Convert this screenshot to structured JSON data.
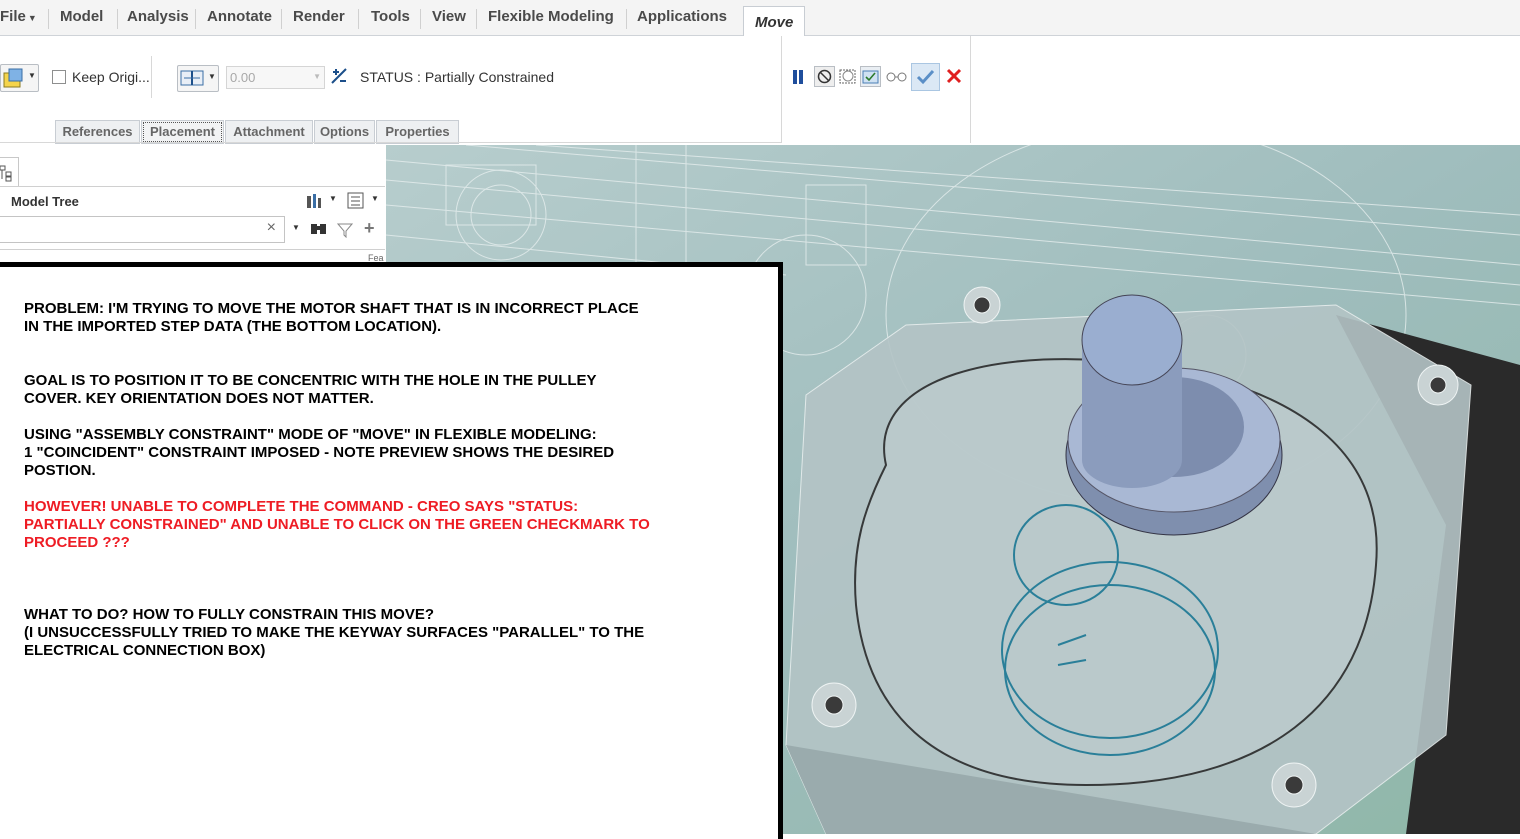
{
  "menu": {
    "file": "File",
    "model": "Model",
    "analysis": "Analysis",
    "annotate": "Annotate",
    "render": "Render",
    "tools": "Tools",
    "view": "View",
    "flexible_modeling": "Flexible Modeling",
    "applications": "Applications",
    "move": "Move"
  },
  "ribbon": {
    "keep_original": "Keep Origi...",
    "offset_value": "0.00",
    "status": "STATUS : Partially Constrained"
  },
  "subtabs": [
    "References",
    "Placement",
    "Attachment",
    "Options",
    "Properties"
  ],
  "model_tree": {
    "title": "Model Tree",
    "clear": "×",
    "column_hint": "Fea"
  },
  "note": {
    "p1": "PROBLEM: I'M TRYING TO MOVE THE MOTOR SHAFT THAT IS IN INCORRECT PLACE\nIN THE IMPORTED STEP DATA (THE BOTTOM LOCATION).",
    "p2": "GOAL IS TO POSITION IT TO BE CONCENTRIC WITH THE HOLE IN THE PULLEY\nCOVER.  KEY ORIENTATION DOES NOT MATTER.",
    "p3": "USING \"ASSEMBLY CONSTRAINT\" MODE OF \"MOVE\" IN FLEXIBLE MODELING:\n1 \"COINCIDENT\" CONSTRAINT IMPOSED - NOTE PREVIEW SHOWS THE DESIRED\nPOSTION.",
    "p4": "HOWEVER!  UNABLE TO COMPLETE THE COMMAND - CREO SAYS \"STATUS:\nPARTIALLY CONSTRAINED\" AND UNABLE TO CLICK ON THE GREEN CHECKMARK TO\nPROCEED ???",
    "p5": "WHAT TO DO?  HOW TO FULLY CONSTRAIN THIS MOVE?\n(I UNSUCCESSFULLY TRIED TO MAKE THE KEYWAY SURFACES \"PARALLEL\" TO THE\nELECTRICAL CONNECTION BOX)"
  },
  "colors": {
    "status_red": "#ee1c24",
    "confirm_blue": "#5b8fc7",
    "cancel_red": "#e02020",
    "viewport_teal": "#9fbdbd"
  }
}
